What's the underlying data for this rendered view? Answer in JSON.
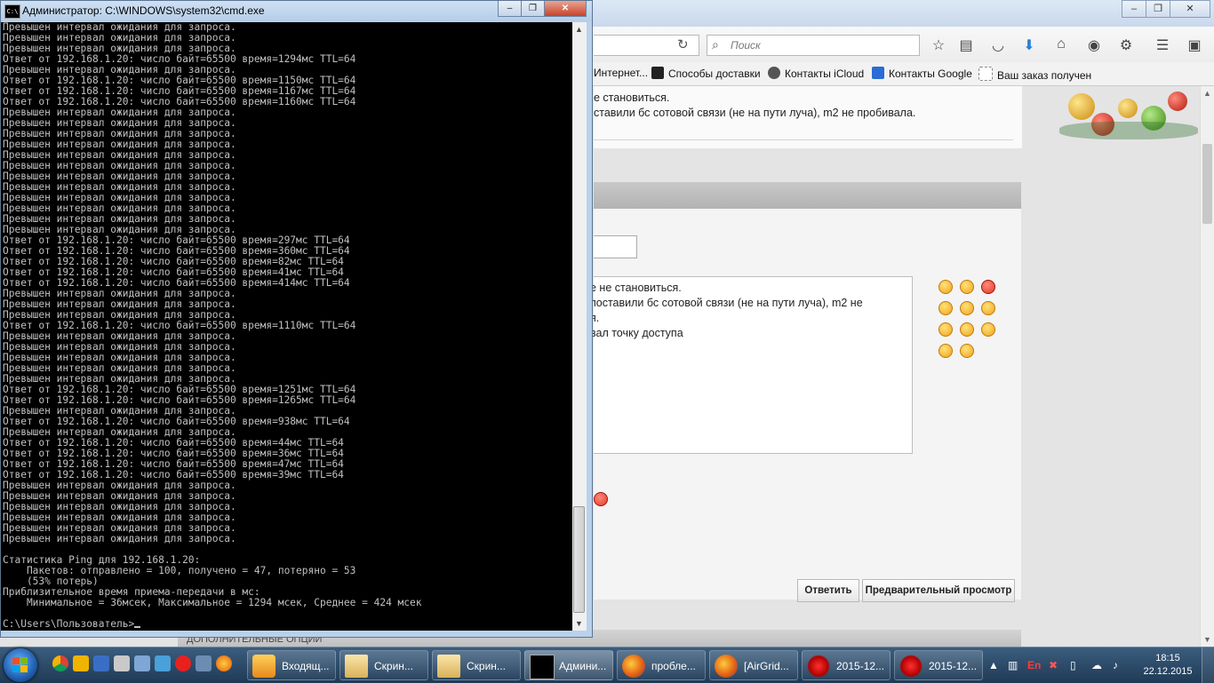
{
  "cmd": {
    "title": "Администратор: C:\\WINDOWS\\system32\\cmd.exe",
    "lines": [
      "Превышен интервал ожидания для запроса.",
      "Превышен интервал ожидания для запроса.",
      "Превышен интервал ожидания для запроса.",
      "Ответ от 192.168.1.20: число байт=65500 время=1294мс TTL=64",
      "Превышен интервал ожидания для запроса.",
      "Ответ от 192.168.1.20: число байт=65500 время=1150мс TTL=64",
      "Ответ от 192.168.1.20: число байт=65500 время=1167мс TTL=64",
      "Ответ от 192.168.1.20: число байт=65500 время=1160мс TTL=64",
      "Превышен интервал ожидания для запроса.",
      "Превышен интервал ожидания для запроса.",
      "Превышен интервал ожидания для запроса.",
      "Превышен интервал ожидания для запроса.",
      "Превышен интервал ожидания для запроса.",
      "Превышен интервал ожидания для запроса.",
      "Превышен интервал ожидания для запроса.",
      "Превышен интервал ожидания для запроса.",
      "Превышен интервал ожидания для запроса.",
      "Превышен интервал ожидания для запроса.",
      "Превышен интервал ожидания для запроса.",
      "Превышен интервал ожидания для запроса.",
      "Ответ от 192.168.1.20: число байт=65500 время=297мс TTL=64",
      "Ответ от 192.168.1.20: число байт=65500 время=360мс TTL=64",
      "Ответ от 192.168.1.20: число байт=65500 время=82мс TTL=64",
      "Ответ от 192.168.1.20: число байт=65500 время=41мс TTL=64",
      "Ответ от 192.168.1.20: число байт=65500 время=414мс TTL=64",
      "Превышен интервал ожидания для запроса.",
      "Превышен интервал ожидания для запроса.",
      "Превышен интервал ожидания для запроса.",
      "Ответ от 192.168.1.20: число байт=65500 время=1110мс TTL=64",
      "Превышен интервал ожидания для запроса.",
      "Превышен интервал ожидания для запроса.",
      "Превышен интервал ожидания для запроса.",
      "Превышен интервал ожидания для запроса.",
      "Превышен интервал ожидания для запроса.",
      "Ответ от 192.168.1.20: число байт=65500 время=1251мс TTL=64",
      "Ответ от 192.168.1.20: число байт=65500 время=1265мс TTL=64",
      "Превышен интервал ожидания для запроса.",
      "Ответ от 192.168.1.20: число байт=65500 время=938мс TTL=64",
      "Превышен интервал ожидания для запроса.",
      "Ответ от 192.168.1.20: число байт=65500 время=44мс TTL=64",
      "Ответ от 192.168.1.20: число байт=65500 время=36мс TTL=64",
      "Ответ от 192.168.1.20: число байт=65500 время=47мс TTL=64",
      "Ответ от 192.168.1.20: число байт=65500 время=39мс TTL=64",
      "Превышен интервал ожидания для запроса.",
      "Превышен интервал ожидания для запроса.",
      "Превышен интервал ожидания для запроса.",
      "Превышен интервал ожидания для запроса.",
      "Превышен интервал ожидания для запроса.",
      "Превышен интервал ожидания для запроса.",
      "",
      "Статистика Ping для 192.168.1.20:",
      "    Пакетов: отправлено = 100, получено = 47, потеряно = 53",
      "    (53% потерь)",
      "Приблизительное время приема-передачи в мс:",
      "    Минимальное = 36мсек, Максимальное = 1294 мсек, Среднее = 424 мсек",
      ""
    ],
    "prompt": "C:\\Users\\Пользователь>"
  },
  "browser": {
    "search_placeholder": "Поиск",
    "bookmarks": [
      "Интернет...",
      "Способы доставки",
      "Контакты iCloud",
      "Контакты Google",
      "Ваш заказ получен"
    ],
    "post_lines": [
      "е становиться.",
      "ставили бс сотовой связи (не на пути луча), m2 не пробивала."
    ],
    "message_lines": [
      "е не становиться.",
      "поставили бс сотовой связи (не на пути луча), m2 не",
      "я.",
      "вал точку доступа"
    ],
    "reply_button": "Ответить",
    "preview_button": "Предварительный просмотр",
    "extra_options": "ДОПОЛНИТЕЛЬНЫЕ ОПЦИИ"
  },
  "taskbar": {
    "items": [
      "Входящ...",
      "Скрин...",
      "Скрин...",
      "Админи...",
      "пробле...",
      "[AirGrid...",
      "2015-12...",
      "2015-12..."
    ],
    "language": "En",
    "time": "18:15",
    "date": "22.12.2015"
  }
}
